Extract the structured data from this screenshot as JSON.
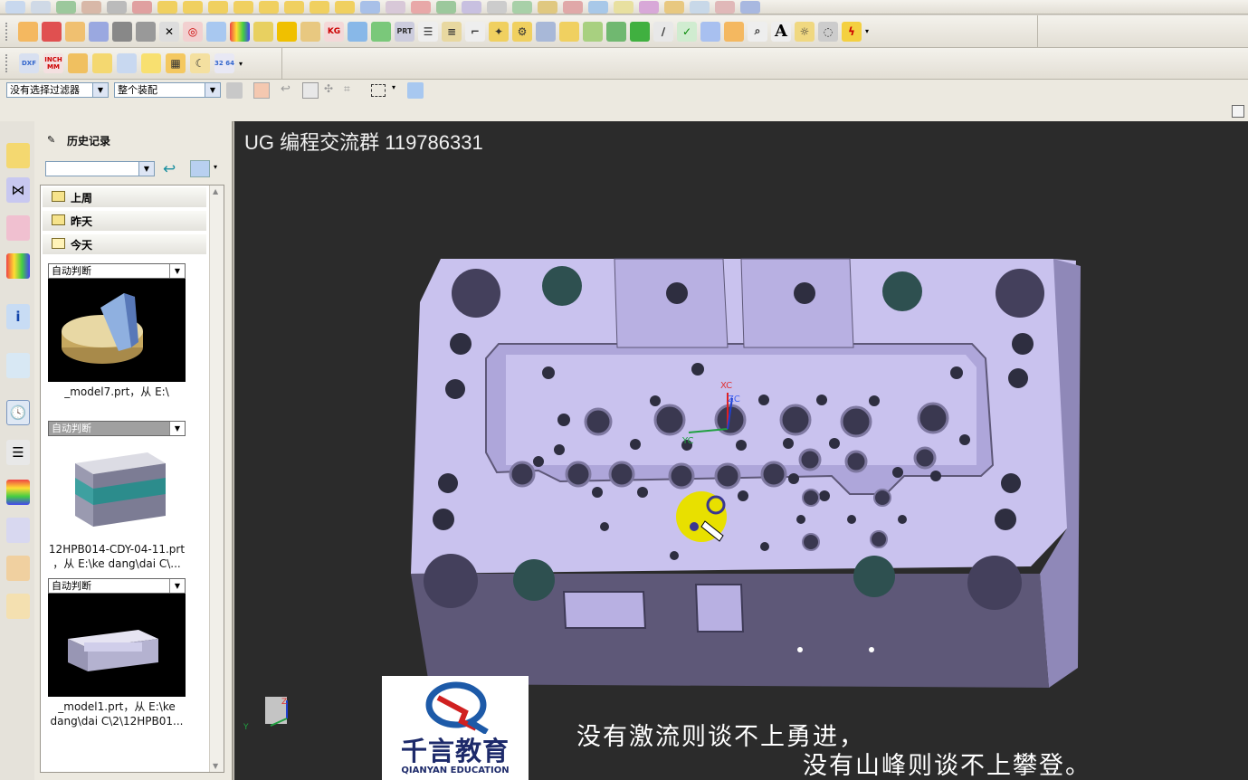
{
  "selection_bar": {
    "filter_value": "没有选择过滤器",
    "scope_value": "整个装配"
  },
  "history_panel": {
    "title": "历史记录",
    "folders": [
      "上周",
      "昨天",
      "今天"
    ],
    "cards": [
      {
        "mode": "自动判断",
        "caption_line1": "_model7.prt，从 E:\\",
        "caption_line2": ""
      },
      {
        "mode": "自动判断",
        "caption_line1": "12HPB014-CDY-04-11.prt",
        "caption_line2": "，从 E:\\ke dang\\dai C\\..."
      },
      {
        "mode": "自动判断",
        "caption_line1": "_model1.prt，从 E:\\ke",
        "caption_line2": "dang\\dai C\\2\\12HPB01..."
      }
    ]
  },
  "viewport": {
    "title": "UG 编程交流群 119786331",
    "axis_labels": {
      "xc": "XC",
      "yc": "YC",
      "zc": "ZC"
    },
    "triad_labels": {
      "z": "Z",
      "y": "Y"
    },
    "logo": {
      "name": "千言教育",
      "sub": "QIANYAN EDUCATION"
    },
    "subtitle_line1": "没有激流则谈不上勇进，",
    "subtitle_line2": "没有山峰则谈不上攀登。"
  },
  "toolbar": {
    "units_label": "INCH MM",
    "text_tool": "A",
    "fraction_label": "32 64"
  },
  "colors": {
    "part_face": "#c9c2ee",
    "part_side": "#8f88b8",
    "viewport_bg": "#2b2b2b",
    "highlight": "#e8e000"
  }
}
